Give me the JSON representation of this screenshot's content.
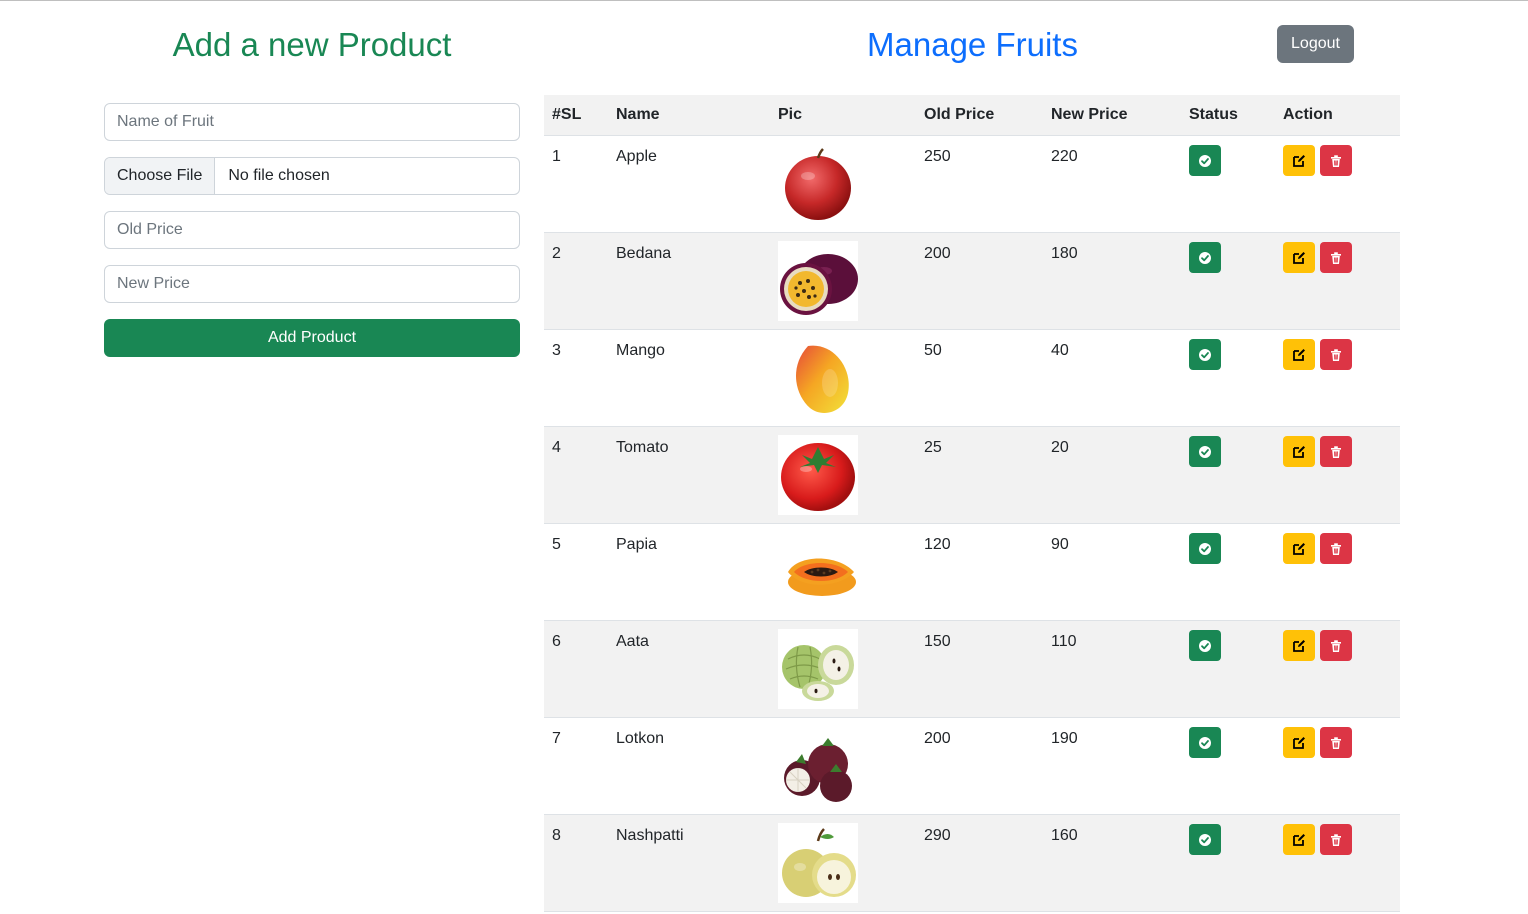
{
  "form": {
    "title": "Add a new Product",
    "name_placeholder": "Name of Fruit",
    "file_button": "Choose File",
    "file_status": "No file chosen",
    "old_price_placeholder": "Old Price",
    "new_price_placeholder": "New Price",
    "submit_label": "Add Product"
  },
  "manage": {
    "title": "Manage Fruits",
    "logout_label": "Logout"
  },
  "table": {
    "headers": [
      "#SL",
      "Name",
      "Pic",
      "Old Price",
      "New Price",
      "Status",
      "Action"
    ],
    "rows": [
      {
        "sl": "1",
        "name": "Apple",
        "old": "250",
        "new": "220",
        "pic": "apple"
      },
      {
        "sl": "2",
        "name": "Bedana",
        "old": "200",
        "new": "180",
        "pic": "passionfruit"
      },
      {
        "sl": "3",
        "name": "Mango",
        "old": "50",
        "new": "40",
        "pic": "mango"
      },
      {
        "sl": "4",
        "name": "Tomato",
        "old": "25",
        "new": "20",
        "pic": "tomato"
      },
      {
        "sl": "5",
        "name": "Papia",
        "old": "120",
        "new": "90",
        "pic": "papaya"
      },
      {
        "sl": "6",
        "name": "Aata",
        "old": "150",
        "new": "110",
        "pic": "custard-apple"
      },
      {
        "sl": "7",
        "name": "Lotkon",
        "old": "200",
        "new": "190",
        "pic": "mangosteen"
      },
      {
        "sl": "8",
        "name": "Nashpatti",
        "old": "290",
        "new": "160",
        "pic": "pear"
      }
    ]
  },
  "colors": {
    "success": "#198754",
    "primary": "#0d6efd",
    "secondary": "#6c757d",
    "warning": "#ffc107",
    "danger": "#dc3545"
  },
  "icons": {
    "status": "check-circle-icon",
    "edit": "edit-icon",
    "delete": "trash-icon"
  }
}
